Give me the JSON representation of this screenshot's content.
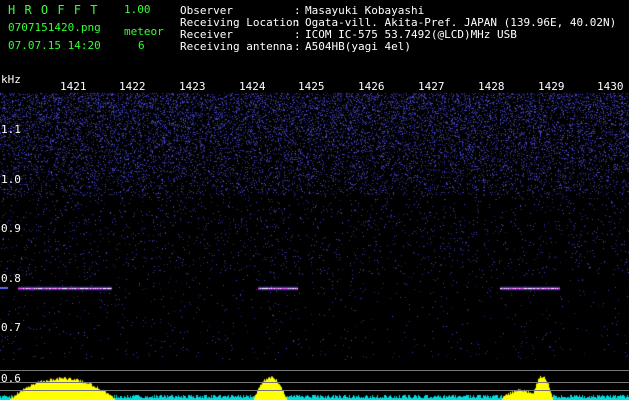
{
  "app": {
    "title": "H R O F F T",
    "version": "1.00",
    "filename": "0707151420.png",
    "datetime": "07.07.15 14:20"
  },
  "meteor": {
    "label": "meteor",
    "count": "6"
  },
  "info": [
    {
      "key": "Observer",
      "sep": ":",
      "value": "Masayuki Kobayashi"
    },
    {
      "key": "Receiving Location",
      "sep": ":",
      "value": "Ogata-vill. Akita-Pref. JAPAN (139.96E, 40.02N)"
    },
    {
      "key": "Receiver",
      "sep": ":",
      "value": "ICOM IC-575 53.7492(@LCD)MHz USB"
    },
    {
      "key": "Receiving antenna",
      "sep": ":",
      "value": "A504HB(yagi 4el)"
    }
  ],
  "spectrogram": {
    "unit_label": "kHz",
    "time_ticks": [
      "1421",
      "1422",
      "1423",
      "1424",
      "1425",
      "1426",
      "1427",
      "1428",
      "1429",
      "1430"
    ],
    "freq_ticks": [
      "1.1",
      "1.0",
      "0.9",
      "0.8",
      "0.7",
      "0.6"
    ],
    "colors": {
      "background": "#000000",
      "noise": "#3a3aff",
      "echo": "#ff55ff",
      "level": "#ffff00",
      "baseline": "#00dddd"
    }
  }
}
